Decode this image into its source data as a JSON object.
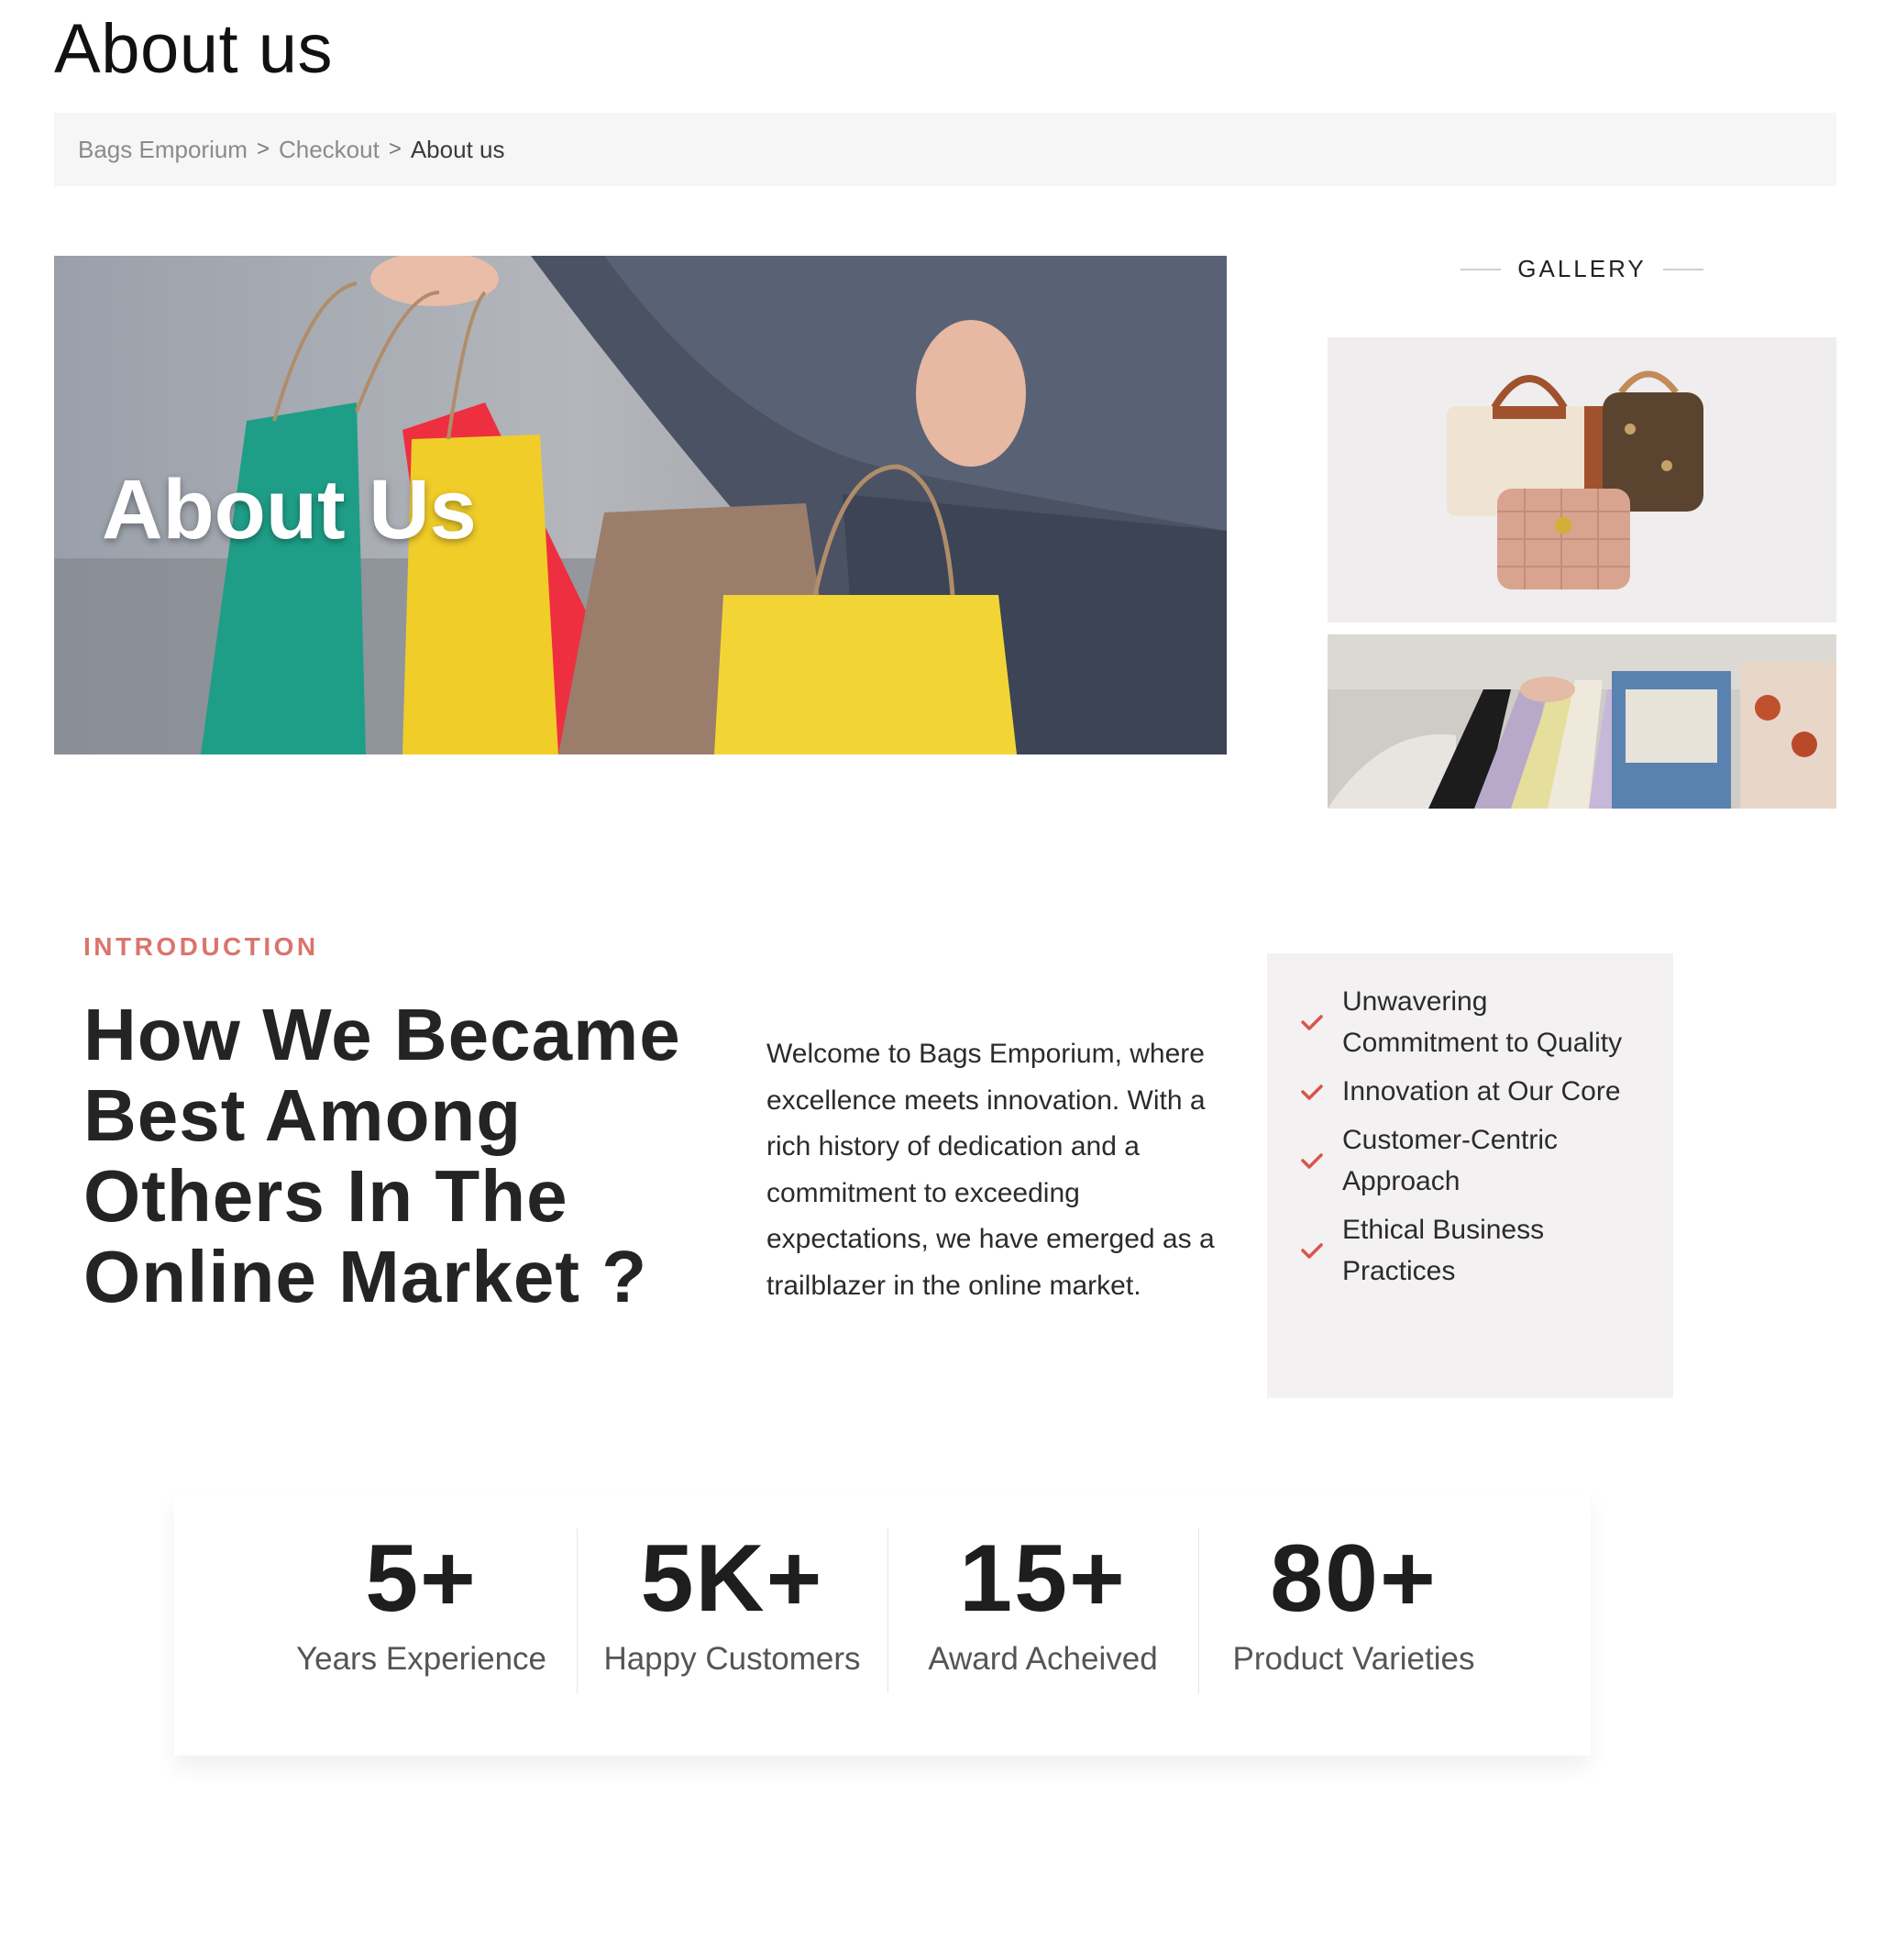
{
  "page": {
    "title": "About us"
  },
  "breadcrumb": {
    "items": [
      "Bags Emporium",
      "Checkout",
      "About us"
    ],
    "separator": ">"
  },
  "hero": {
    "title": "About Us"
  },
  "gallery": {
    "heading": "GALLERY"
  },
  "intro": {
    "label": "INTRODUCTION",
    "heading": "How We Became Best Among Others In The Online Market ?",
    "text": "Welcome to Bags Emporium, where excellence meets innovation. With a rich history of dedication and a commitment to exceeding expectations, we have emerged as a trailblazer in the online market."
  },
  "features": [
    "Unwavering Commitment to Quality",
    "Innovation at Our Core",
    "Customer-Centric Approach",
    "Ethical Business Practices"
  ],
  "stats": [
    {
      "value": "5+",
      "label": "Years Experience"
    },
    {
      "value": "5K+",
      "label": "Happy Customers"
    },
    {
      "value": "15+",
      "label": "Award Acheived"
    },
    {
      "value": "80+",
      "label": "Product Varieties"
    }
  ],
  "colors": {
    "accent": "#d9756c",
    "check": "#d8544c",
    "breadcrumb_bg": "#f6f6f6",
    "feature_bg": "#f3f1f1"
  }
}
